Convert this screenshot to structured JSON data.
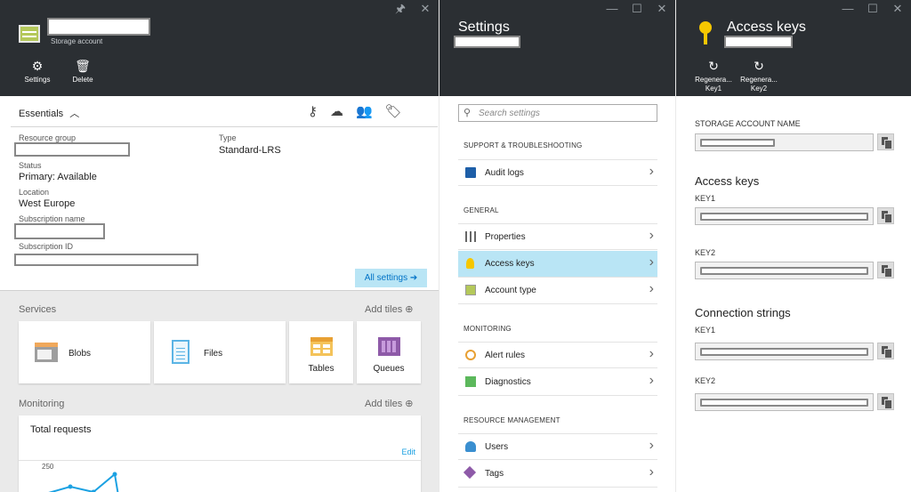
{
  "blade1": {
    "subtitle": "Storage account",
    "buttons": [
      {
        "label": "Settings"
      },
      {
        "label": "Delete"
      }
    ],
    "essentials_label": "Essentials",
    "fields": {
      "resource_group_label": "Resource group",
      "status_label": "Status",
      "status_value": "Primary: Available",
      "location_label": "Location",
      "location_value": "West Europe",
      "subscription_name_label": "Subscription name",
      "subscription_id_label": "Subscription ID",
      "type_label": "Type",
      "type_value": "Standard-LRS"
    },
    "all_settings": "All settings ➔",
    "services_label": "Services",
    "add_tiles": "Add tiles ⊕",
    "tiles": [
      {
        "label": "Blobs"
      },
      {
        "label": "Files"
      },
      {
        "label": "Tables"
      },
      {
        "label": "Queues"
      }
    ],
    "monitoring_label": "Monitoring",
    "chart_title": "Total requests",
    "chart_edit": "Edit",
    "chart_tick": "250"
  },
  "blade2": {
    "title": "Settings",
    "search_placeholder": "Search settings",
    "sections": {
      "support": "SUPPORT & TROUBLESHOOTING",
      "general": "GENERAL",
      "monitoring": "MONITORING",
      "resource": "RESOURCE MANAGEMENT"
    },
    "items": {
      "audit_logs": "Audit logs",
      "properties": "Properties",
      "access_keys": "Access keys",
      "account_type": "Account type",
      "alert_rules": "Alert rules",
      "diagnostics": "Diagnostics",
      "users": "Users",
      "tags": "Tags"
    }
  },
  "blade3": {
    "title": "Access keys",
    "buttons": [
      {
        "label1": "Regenera...",
        "label2": "Key1"
      },
      {
        "label1": "Regenera...",
        "label2": "Key2"
      }
    ],
    "storage_account_name_label": "STORAGE ACCOUNT NAME",
    "access_keys_heading": "Access keys",
    "key1": "KEY1",
    "key2": "KEY2",
    "connection_strings_heading": "Connection strings"
  },
  "colors": {
    "header_bg": "#2b2f33",
    "active_row": "#b9e5f5",
    "accent": "#1ba1e2"
  }
}
